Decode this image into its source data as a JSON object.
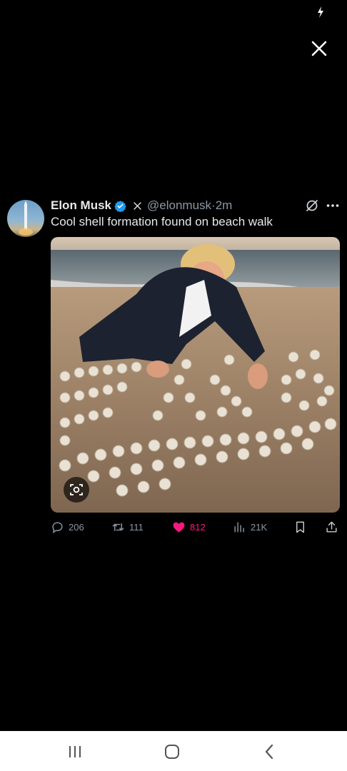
{
  "viewer": {
    "close_icon": "close-icon",
    "status_icon": "charging-icon"
  },
  "tweet": {
    "author_name": "Elon Musk",
    "verified_icon": "verified-badge-icon",
    "x_logo_icon": "x-logo-icon",
    "handle_time": "@elonmusk·2m",
    "text": "Cool shell formation found on beach walk",
    "photo_description_icon": "photo-image",
    "media_lens_icon": "lens-search-icon",
    "colors": {
      "like": "#f91880",
      "verified": "#1d9bf0",
      "muted": "#8b98a5"
    }
  },
  "actions": {
    "replies": "206",
    "retweets": "111",
    "likes": "812",
    "views": "21K"
  },
  "navbar": {
    "recents_icon": "recents-icon",
    "home_icon": "home-icon",
    "back_icon": "back-icon"
  }
}
